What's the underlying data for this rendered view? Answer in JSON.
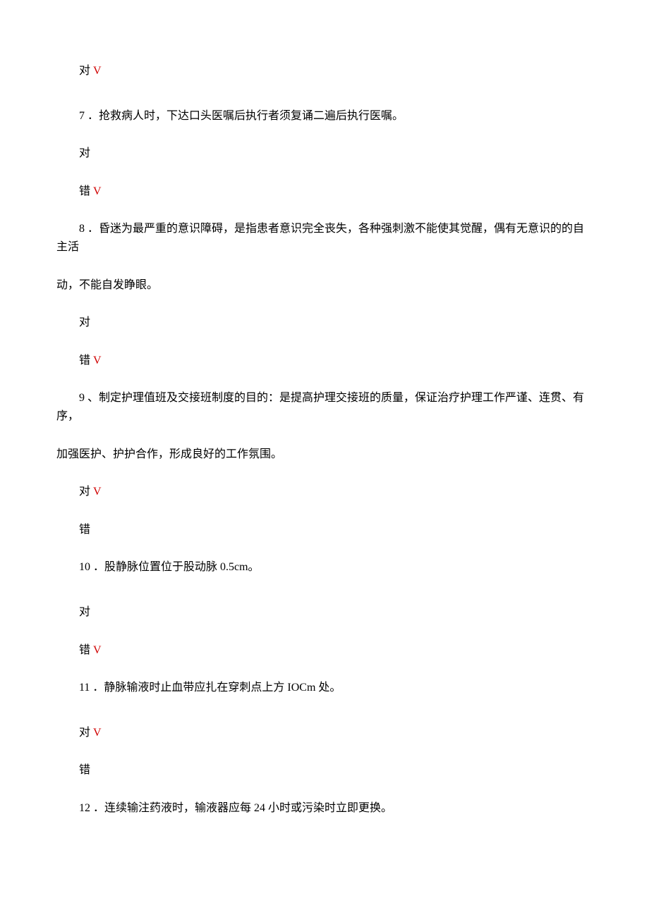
{
  "marks": {
    "check": "V"
  },
  "items": [
    {
      "lead": {
        "text": "对",
        "checked": true
      }
    },
    {
      "num": "7",
      "qline1": "．抢救病人时，下达口头医嘱后执行者须复诵二遍后执行医嘱。",
      "a1": {
        "text": "对",
        "checked": false
      },
      "a2": {
        "text": "错",
        "checked": true
      }
    },
    {
      "num": "8",
      "qline1": "．昏迷为最严重的意识障碍，是指患者意识完全丧失，各种强刺激不能使其觉醒，偶有无意识的的自主活",
      "qline2": "动，不能自发睁眼。",
      "a1": {
        "text": "对",
        "checked": false
      },
      "a2": {
        "text": "错",
        "checked": true
      }
    },
    {
      "num": "9",
      "qline1": "、制定护理值班及交接班制度的目的：是提高护理交接班的质量，保证治疗护理工作严谨、连贯、有序，",
      "qline2": "加强医护、护护合作，形成良好的工作氛围。",
      "a1": {
        "text": "对",
        "checked": true
      },
      "a2": {
        "text": "错",
        "checked": false
      }
    },
    {
      "num": "10",
      "qline1": "．股静脉位置位于股动脉 0.5cm。",
      "a1": {
        "text": "对",
        "checked": false
      },
      "a2": {
        "text": "错",
        "checked": true
      }
    },
    {
      "num": "11",
      "qline1": "．静脉输液时止血带应扎在穿刺点上方 IOCm 处。",
      "a1": {
        "text": "对",
        "checked": true
      },
      "a2": {
        "text": "错",
        "checked": false
      }
    },
    {
      "num": "12",
      "qline1": "．连续输注药液时，输液器应每 24 小时或污染时立即更换。"
    }
  ]
}
